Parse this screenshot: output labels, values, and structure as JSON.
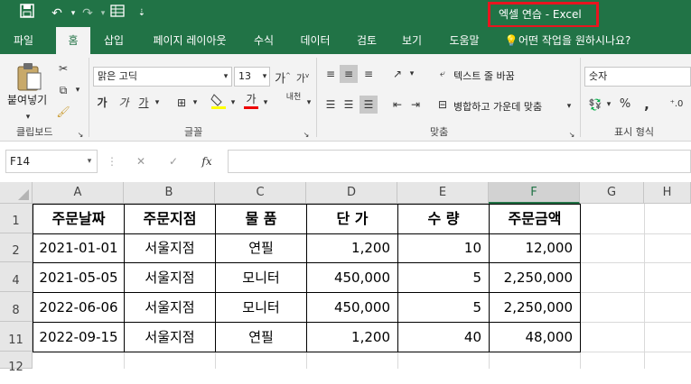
{
  "window": {
    "title": "엑셀 연습  -  Excel",
    "accent_color": "#217346",
    "highlight_color": "#e8151f"
  },
  "quick_access": {
    "save_icon": "save-icon",
    "undo_icon": "undo-icon",
    "redo_icon": "redo-icon",
    "form_icon": "form-icon",
    "customize_icon": "customize-icon"
  },
  "tabs": [
    "파일",
    "홈",
    "삽입",
    "페이지 레이아웃",
    "수식",
    "데이터",
    "검토",
    "보기",
    "도움말"
  ],
  "active_tab": "홈",
  "tell_me": "어떤 작업을 원하시나요?",
  "ribbon": {
    "clipboard": {
      "paste_label": "붙여넣기",
      "group_label": "클립보드"
    },
    "font": {
      "font_name": "맑은 고딕",
      "font_size": "13",
      "bold": "가",
      "italic": "가",
      "underline": "가",
      "font_color_glyph": "가",
      "phonetic": "내천",
      "group_label": "글꼴"
    },
    "alignment": {
      "wrap_text": "텍스트 줄 바꿈",
      "merge_center": "병합하고 가운데 맞춤",
      "group_label": "맞춤"
    },
    "number": {
      "format": "숫자",
      "percent": "%",
      "comma": ",",
      "group_label": "표시 형식"
    }
  },
  "formula_bar": {
    "name_box": "F14",
    "cancel": "✕",
    "enter": "✓",
    "fx": "fx",
    "value": ""
  },
  "sheet": {
    "columns": [
      "A",
      "B",
      "C",
      "D",
      "E",
      "F",
      "G",
      "H"
    ],
    "selected_column": "F",
    "row_numbers": [
      "1",
      "2",
      "4",
      "8",
      "11",
      "12"
    ],
    "headers": [
      "주문날짜",
      "주문지점",
      "물 품",
      "단 가",
      "수 량",
      "주문금액"
    ],
    "rows": [
      [
        "2021-01-01",
        "서울지점",
        "연필",
        "1,200",
        "10",
        "12,000"
      ],
      [
        "2021-05-05",
        "서울지점",
        "모니터",
        "450,000",
        "5",
        "2,250,000"
      ],
      [
        "2022-06-06",
        "서울지점",
        "모니터",
        "450,000",
        "5",
        "2,250,000"
      ],
      [
        "2022-09-15",
        "서울지점",
        "연필",
        "1,200",
        "40",
        "48,000"
      ]
    ]
  }
}
